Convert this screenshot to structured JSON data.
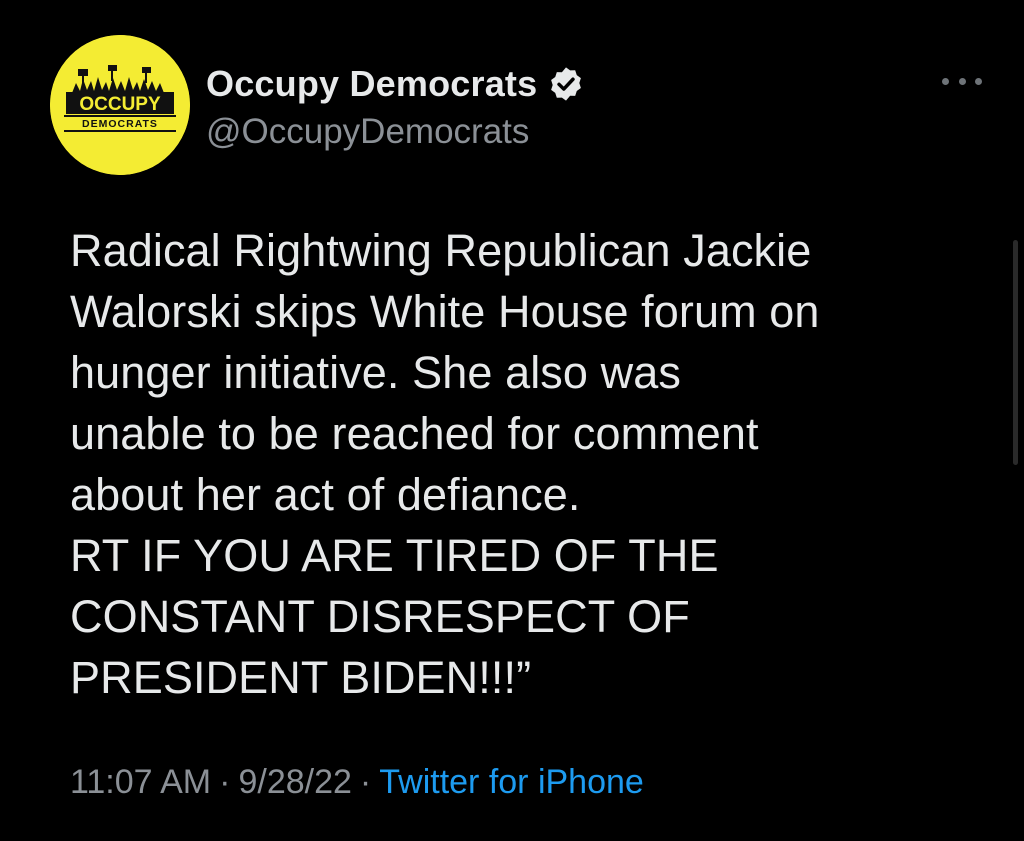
{
  "account": {
    "display_name": "Occupy Democrats",
    "handle": "@OccupyDemocrats",
    "verified_icon": "verified-badge-icon",
    "avatar_logo_line1": "OCCUPY",
    "avatar_logo_line2": "DEMOCRATS",
    "avatar_color": "#f4ec33"
  },
  "more_menu_icon": "more-options-icon",
  "tweet": {
    "lines": [
      "Radical Rightwing Republican Jackie",
      "Walorski skips White House forum on",
      "hunger initiative. She also was",
      "unable to be reached for comment",
      "about her act of defiance.",
      "RT IF YOU ARE TIRED OF THE",
      "CONSTANT DISRESPECT OF",
      "PRESIDENT BIDEN!!!”"
    ]
  },
  "meta": {
    "time": "11:07 AM",
    "separator": "·",
    "date": "9/28/22",
    "source": "Twitter for iPhone"
  },
  "colors": {
    "background": "#000000",
    "text": "#e7e9ea",
    "muted": "#8b9096",
    "link": "#1d9bf0",
    "verified_badge": "#e7e9ea"
  }
}
